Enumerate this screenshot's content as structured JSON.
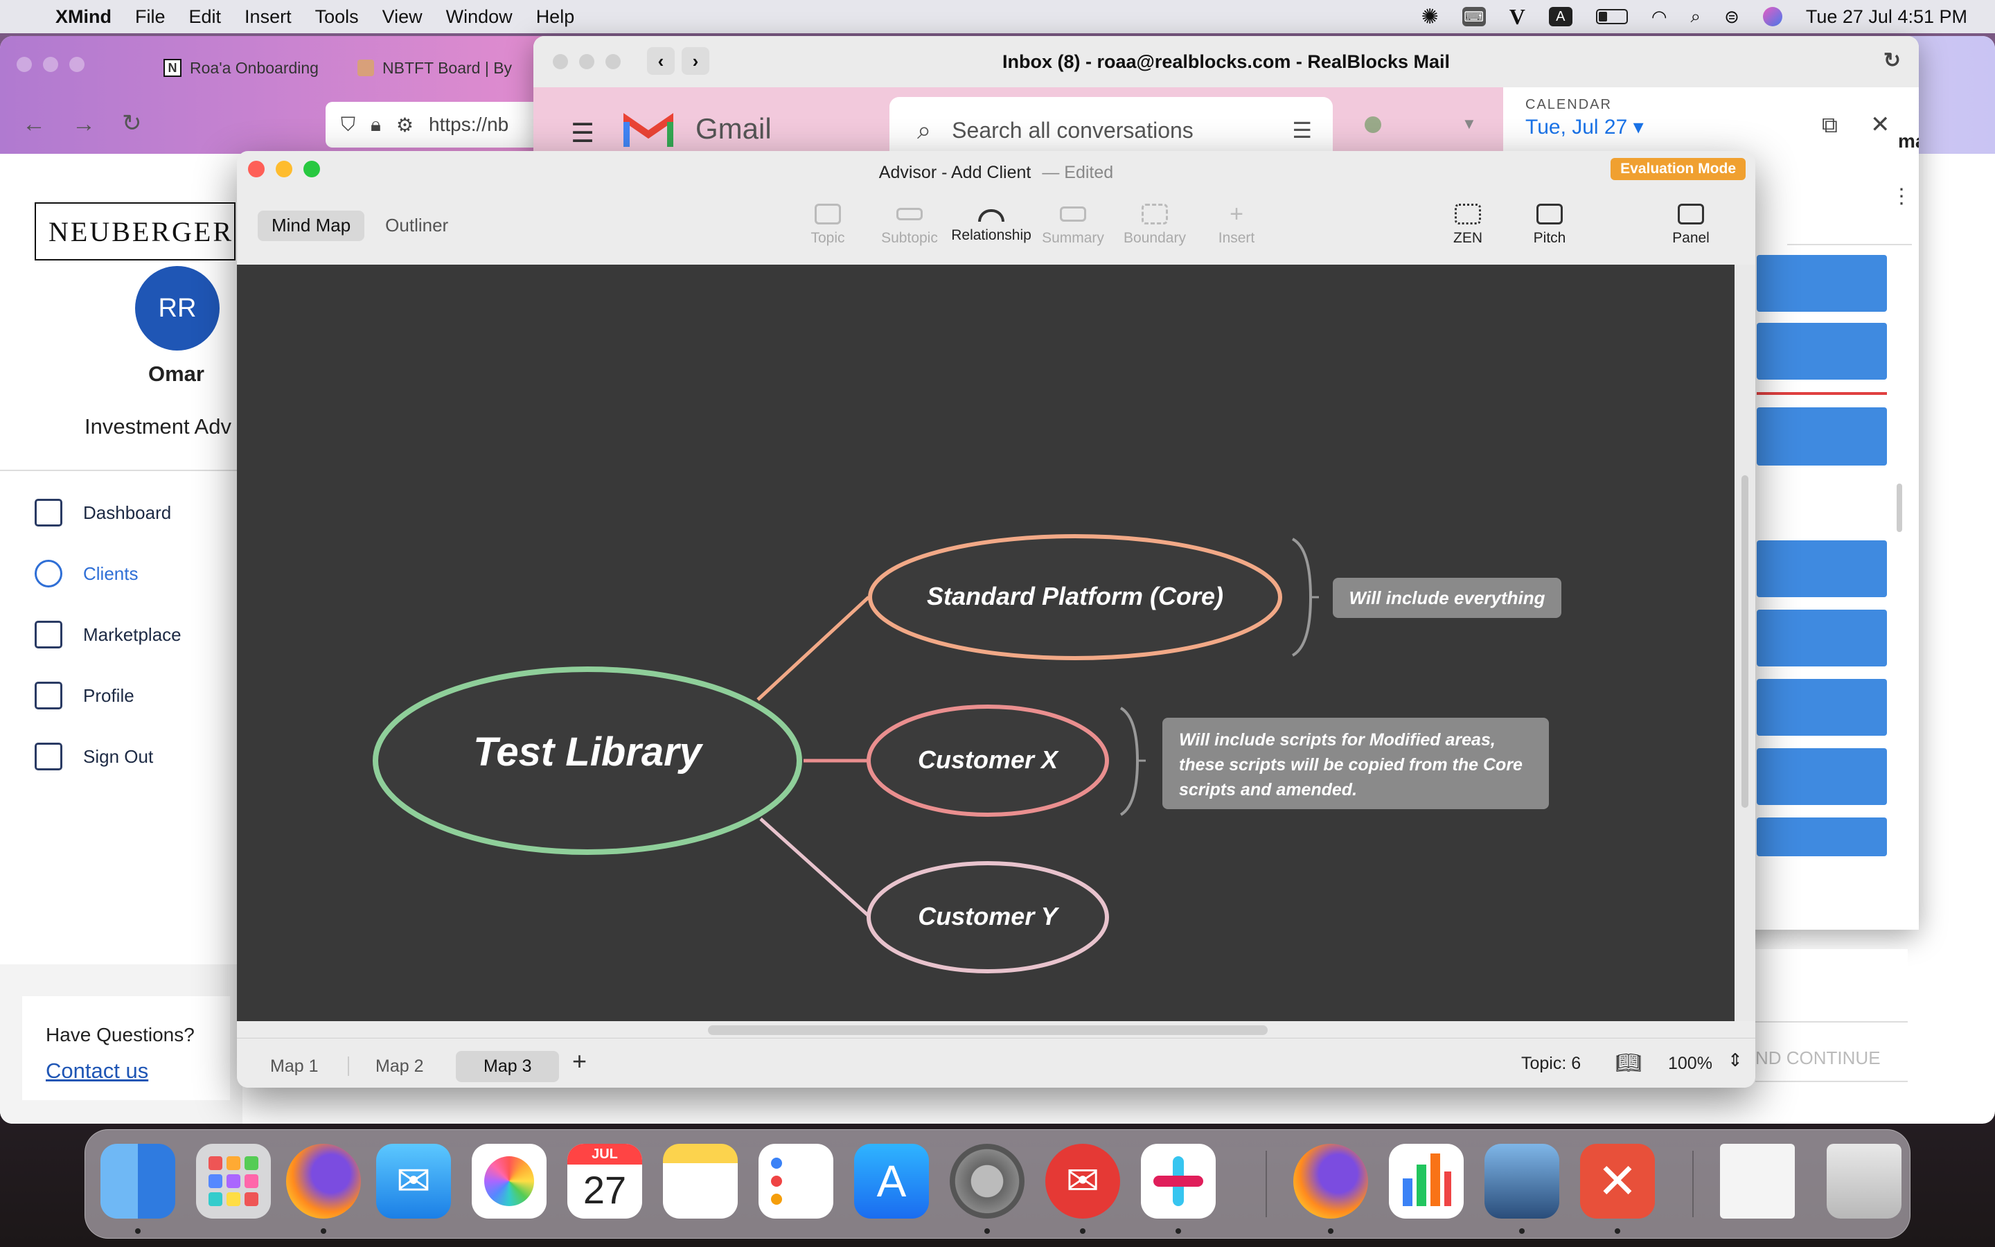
{
  "menubar": {
    "app": "XMind",
    "items": [
      "File",
      "Edit",
      "Insert",
      "Tools",
      "View",
      "Window",
      "Help"
    ],
    "clock": "Tue 27 Jul  4:51 PM"
  },
  "browser": {
    "tabs": [
      "Roa'a Onboarding",
      "NBTFT Board | By"
    ],
    "url": "https://nb"
  },
  "leftapp": {
    "logo": "NEUBERGER",
    "avatar_initials": "RR",
    "user_name": "Omar",
    "user_role": "Investment Adv",
    "nav": [
      "Dashboard",
      "Clients",
      "Marketplace",
      "Profile",
      "Sign Out"
    ],
    "help_title": "Have Questions?",
    "help_link": "Contact us"
  },
  "gmail": {
    "window_title": "Inbox (8) - roaa@realblocks.com - RealBlocks Mail",
    "brand": "Gmail",
    "search_placeholder": "Search all conversations",
    "calendar_label": "CALENDAR",
    "calendar_date": "Tue, Jul 27 ▾",
    "right_name": "mar",
    "continue_label": "ND CONTINUE"
  },
  "xmind": {
    "title": "Advisor - Add Client",
    "edited": "— Edited",
    "eval_badge": "Evaluation Mode",
    "view_tabs": [
      "Mind Map",
      "Outliner"
    ],
    "tools": [
      "Topic",
      "Subtopic",
      "Relationship",
      "Summary",
      "Boundary",
      "Insert"
    ],
    "right_tools": [
      "ZEN",
      "Pitch",
      "Panel"
    ],
    "map_tabs": [
      "Map 1",
      "Map 2",
      "Map 3"
    ],
    "add_map": "+",
    "topic_count": "Topic: 6",
    "zoom": "100%"
  },
  "mindmap": {
    "central": "Test Library",
    "topics": [
      "Standard Platform (Core)",
      "Customer X",
      "Customer Y"
    ],
    "notes": [
      "Will include everything",
      "Will include scripts for Modified areas, these scripts will be copied from the Core scripts and amended."
    ],
    "colors": {
      "central": "#8fcf9a",
      "topic1": "#f2a987",
      "topic2": "#ea8f8f",
      "topic3": "#e8c3cd",
      "canvas": "#393939",
      "note": "#8a8a8a"
    }
  },
  "dock": {
    "calendar_month": "JUL",
    "calendar_day": "27"
  }
}
